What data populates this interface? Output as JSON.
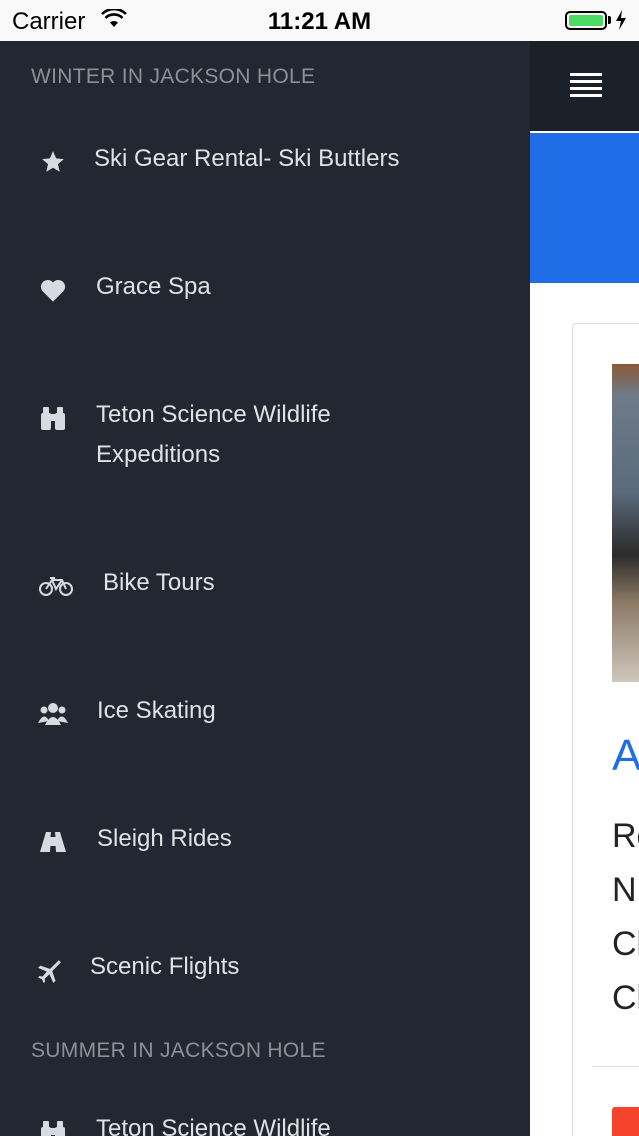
{
  "status_bar": {
    "carrier": "Carrier",
    "time": "11:21 AM"
  },
  "drawer": {
    "winter_header": "WINTER IN JACKSON HOLE",
    "winter_items": [
      {
        "label": "Ski Gear Rental- Ski Buttlers",
        "icon": "star-icon"
      },
      {
        "label": "Grace Spa",
        "icon": "heart-icon"
      },
      {
        "label": "Teton Science Wildlife Expeditions",
        "icon": "binoculars-icon"
      },
      {
        "label": "Bike Tours",
        "icon": "bicycle-icon"
      },
      {
        "label": "Ice Skating",
        "icon": "users-icon"
      },
      {
        "label": "Sleigh Rides",
        "icon": "road-icon"
      },
      {
        "label": "Scenic Flights",
        "icon": "plane-icon"
      }
    ],
    "summer_header": "SUMMER IN JACKSON HOLE",
    "summer_items": [
      {
        "label": "Teton Science Wildlife",
        "icon": "binoculars-icon"
      }
    ]
  },
  "main": {
    "card_title": "A",
    "card_lines": [
      "Re",
      "N",
      "Cl",
      "Cl"
    ]
  }
}
